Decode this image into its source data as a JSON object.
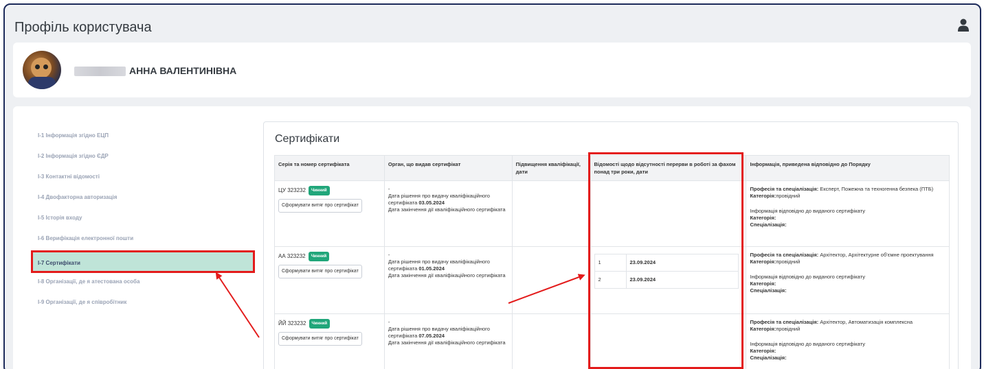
{
  "header": {
    "title": "Профіль користувача",
    "user_icon": "user-icon"
  },
  "profile": {
    "name": "АННА ВАЛЕНТИНІВНА"
  },
  "sidebar": {
    "items": [
      {
        "label": "І-1 Інформація згідно ЕЦП"
      },
      {
        "label": "І-2 Інформація згідно ЄДР"
      },
      {
        "label": "І-3 Контактні відомості"
      },
      {
        "label": "І-4 Двофакторна авторизація"
      },
      {
        "label": "І-5 Історія входу"
      },
      {
        "label": "І-6 Верифікація електронної пошти"
      },
      {
        "label": "І-7 Сертифікати"
      },
      {
        "label": "І-8 Організації, де я атестована особа"
      },
      {
        "label": "І-9 Організації, де я співробітник"
      }
    ],
    "active_index": 6
  },
  "certificates": {
    "title": "Сертифікати",
    "columns": [
      "Серія та номер сертифіката",
      "Орган, що видав сертифікат",
      "Підвищення кваліфікації, дати",
      "Відомості щодо відсутності перерви в роботі за фахом понад три роки, дати",
      "Інформація, приведена відповідно до Порядку"
    ],
    "badge_label": "Чинний",
    "extract_label": "Сформувати витяг про сертифікат",
    "rows": [
      {
        "number": "ЦУ 323232",
        "issuer_dash": "-",
        "decision_label": "Дата рішення про видачу кваліфікаційного сертифіката",
        "decision_date": "03.05.2024",
        "end_label": "Дата закінчення дії кваліфікаційного сертифіката",
        "breaks": [],
        "profession_label": "Професія та спеціалізація:",
        "profession": "Експерт, Пожежна та техногенна безпека (ПТБ)",
        "category_label": "Категорія:",
        "category": "провідний",
        "info_label": "Інформація відповідно до виданого сертифікату",
        "specialization_label": "Спеціалізація:"
      },
      {
        "number": "АА 323232",
        "issuer_dash": "-",
        "decision_label": "Дата рішення про видачу кваліфікаційного сертифіката",
        "decision_date": "01.05.2024",
        "end_label": "Дата закінчення дії кваліфікаційного сертифіката",
        "breaks": [
          {
            "index": "1",
            "date": "23.09.2024"
          },
          {
            "index": "2",
            "date": "23.09.2024"
          }
        ],
        "profession_label": "Професія та спеціалізація:",
        "profession": "Архітектор, Архітектурне об'ємне проектування",
        "category_label": "Категорія:",
        "category": "провідний",
        "info_label": "Інформація відповідно до виданого сертифікату",
        "specialization_label": "Спеціалізація:"
      },
      {
        "number": "ЙЙ 323232",
        "issuer_dash": "-",
        "decision_label": "Дата рішення про видачу кваліфікаційного сертифіката",
        "decision_date": "07.05.2024",
        "end_label": "Дата закінчення дії кваліфікаційного сертифіката",
        "breaks": [],
        "profession_label": "Професія та спеціалізація:",
        "profession": "Архітектор, Автоматизація комплексна",
        "category_label": "Категорія:",
        "category": "провідний",
        "info_label": "Інформація відповідно до виданого сертифікату",
        "specialization_label": "Спеціалізація:"
      }
    ]
  },
  "colors": {
    "accent": "#20a67a",
    "highlight": "#e31b1b",
    "active_bg": "#bfe4d8"
  }
}
